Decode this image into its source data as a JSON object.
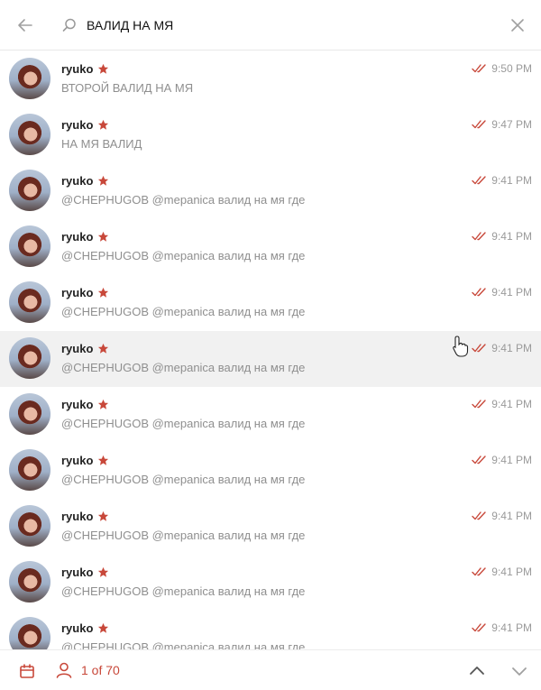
{
  "search": {
    "query": "ВАЛИД НА МЯ",
    "back_icon": "arrow-left-icon",
    "search_icon": "search-icon",
    "clear_icon": "close-icon"
  },
  "colors": {
    "accent": "#c8483a",
    "muted_text": "#8f8f8f",
    "hover_row": "#f1f1f1"
  },
  "results": [
    {
      "name": "ryuko",
      "message": "ВТОРОЙ ВАЛИД НА МЯ",
      "time": "9:50 PM",
      "hovered": false
    },
    {
      "name": "ryuko",
      "message": "НА МЯ ВАЛИД",
      "time": "9:47 PM",
      "hovered": false
    },
    {
      "name": "ryuko",
      "message": "@CHEPHUGOB @mepanica валид на мя где",
      "time": "9:41 PM",
      "hovered": false
    },
    {
      "name": "ryuko",
      "message": "@CHEPHUGOB @mepanica валид на мя где",
      "time": "9:41 PM",
      "hovered": false
    },
    {
      "name": "ryuko",
      "message": "@CHEPHUGOB @mepanica валид на мя где",
      "time": "9:41 PM",
      "hovered": false
    },
    {
      "name": "ryuko",
      "message": "@CHEPHUGOB @mepanica валид на мя где",
      "time": "9:41 PM",
      "hovered": true
    },
    {
      "name": "ryuko",
      "message": "@CHEPHUGOB @mepanica валид на мя где",
      "time": "9:41 PM",
      "hovered": false
    },
    {
      "name": "ryuko",
      "message": "@CHEPHUGOB @mepanica валид на мя где",
      "time": "9:41 PM",
      "hovered": false
    },
    {
      "name": "ryuko",
      "message": "@CHEPHUGOB @mepanica валид на мя где",
      "time": "9:41 PM",
      "hovered": false
    },
    {
      "name": "ryuko",
      "message": "@CHEPHUGOB @mepanica валид на мя где",
      "time": "9:41 PM",
      "hovered": false
    },
    {
      "name": "ryuko",
      "message": "@CHEPHUGOB @mepanica валид на мя где",
      "time": "9:41 PM",
      "hovered": false
    }
  ],
  "footer": {
    "counter": "1 of 70",
    "calendar_icon": "calendar-icon",
    "user_icon": "user-icon",
    "up_icon": "chevron-up-icon",
    "down_icon": "chevron-down-icon"
  }
}
